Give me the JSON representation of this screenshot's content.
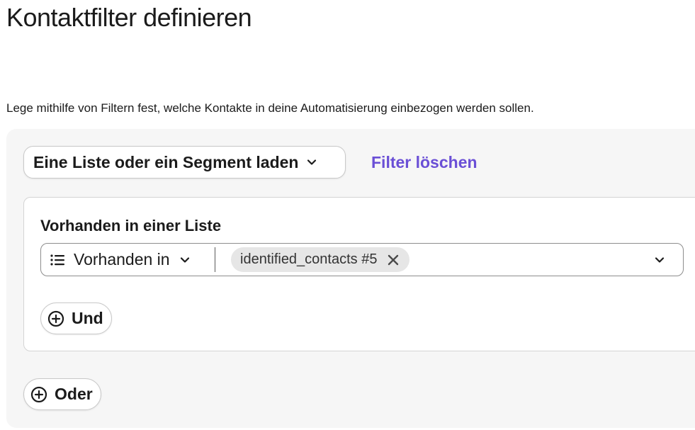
{
  "page": {
    "title": "Kontaktfilter definieren",
    "description": "Lege mithilfe von Filtern fest, welche Kontakte in deine Automatisierung einbezogen werden sollen."
  },
  "toolbar": {
    "load_dropdown_label": "Eine Liste oder ein Segment laden",
    "clear_filter_label": "Filter löschen"
  },
  "filter_group": {
    "title": "Vorhanden in einer Liste",
    "condition": {
      "operator_icon": "list-icon",
      "operator_label": "Vorhanden in",
      "selected_values": [
        {
          "label": "identified_contacts #5"
        }
      ]
    },
    "and_button_label": "Und"
  },
  "or_button_label": "Oder",
  "colors": {
    "accent": "#6a4fd6",
    "panel_background": "#f6f6f6",
    "tag_background": "#e6e6e6",
    "text": "#1b1b1b"
  }
}
